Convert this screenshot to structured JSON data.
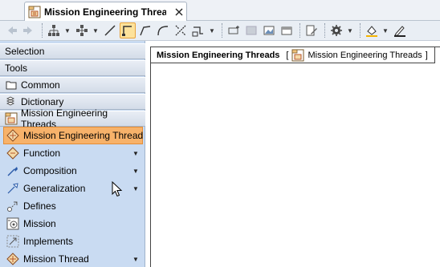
{
  "window": {
    "tab_title": "Mission Engineering Threa",
    "tab_icon": "mission-thread-diagram-icon",
    "close_icon": "close-icon"
  },
  "toolbar": {
    "buttons": [
      "back-icon",
      "forward-icon",
      "layout-tree-icon",
      "layout-icon",
      "line-style-icon",
      "rectilinear-path-icon",
      "oblique-path-icon",
      "bezier-path-icon",
      "split-path-icon",
      "route-path-icon",
      "insert-shape-icon",
      "fill-icon",
      "image-icon",
      "frame-icon",
      "edit-icon",
      "settings-icon",
      "fill-color-icon",
      "pen-icon"
    ]
  },
  "palette": {
    "categories": [
      {
        "label": "Selection"
      },
      {
        "label": "Tools"
      },
      {
        "label": "Common",
        "icon": "folder-icon"
      },
      {
        "label": "Dictionary",
        "icon": "dictionary-icon"
      },
      {
        "label": "Mission Engineering Threads",
        "icon": "mission-thread-diagram-icon"
      }
    ],
    "tools": [
      {
        "label": "Mission Engineering Thread",
        "icon": "mission-thread-icon",
        "selected": true
      },
      {
        "label": "Function",
        "icon": "function-icon",
        "has_arrow": true
      },
      {
        "label": "Composition",
        "icon": "composition-icon",
        "has_arrow": true
      },
      {
        "label": "Generalization",
        "icon": "generalization-icon",
        "has_arrow": true
      },
      {
        "label": "Defines",
        "icon": "defines-icon"
      },
      {
        "label": "Mission",
        "icon": "mission-icon"
      },
      {
        "label": "Implements",
        "icon": "implements-icon"
      },
      {
        "label": "Mission Thread",
        "icon": "mission-thread-icon",
        "has_arrow": true
      }
    ]
  },
  "diagram": {
    "frame_name": "Mission Engineering Threads",
    "frame_type": "Mission Engineering Threads",
    "bracket_open": "[",
    "bracket_close": "]"
  },
  "colors": {
    "palette_bg": "#c9dbf2",
    "selected_bg": "#f7b26a",
    "toolbar_active": "#fde29b"
  }
}
